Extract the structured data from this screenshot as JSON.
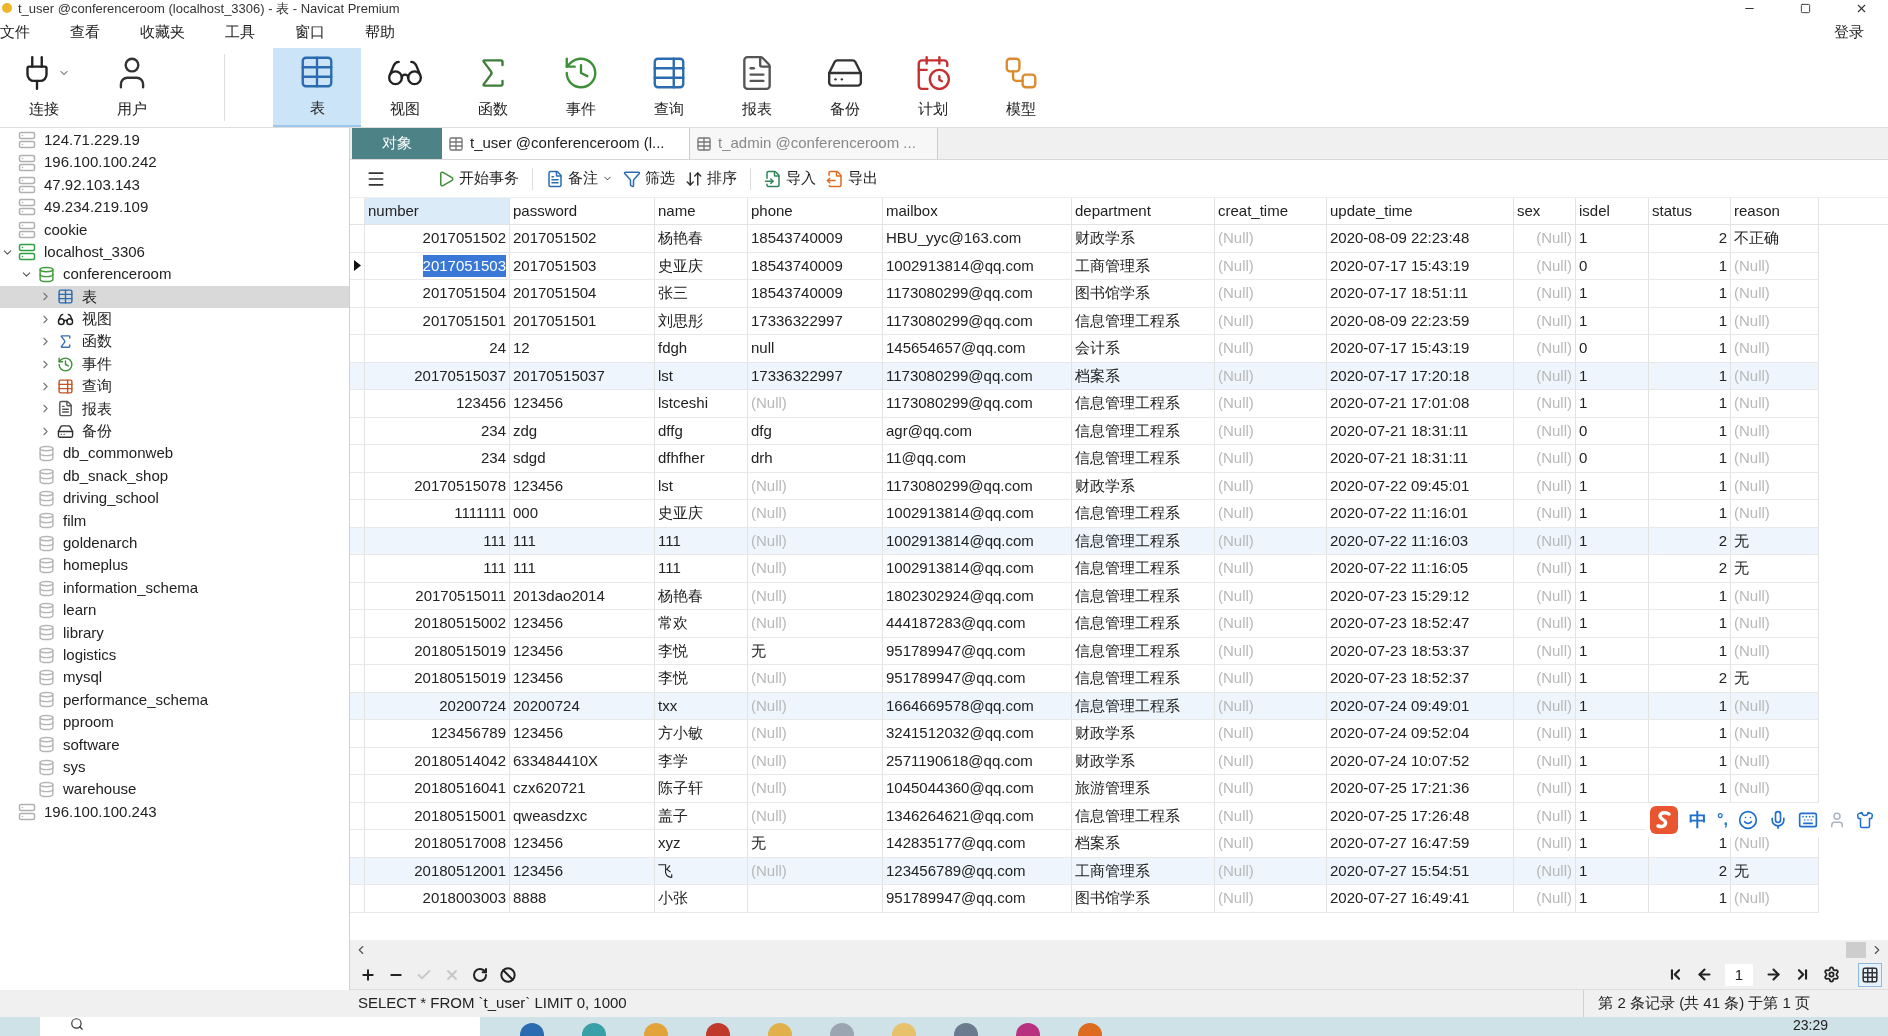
{
  "window": {
    "title": "t_user @conferenceroom (localhost_3306) - 表 - Navicat Premium"
  },
  "menu": [
    "文件",
    "查看",
    "收藏夹",
    "工具",
    "窗口",
    "帮助"
  ],
  "login": "登录",
  "toolbar": [
    {
      "kind": "connection",
      "label": "连接",
      "selected": false
    },
    {
      "kind": "user",
      "label": "用户",
      "selected": false
    },
    {
      "kind": "table",
      "label": "表",
      "selected": true
    },
    {
      "kind": "view",
      "label": "视图",
      "selected": false
    },
    {
      "kind": "function",
      "label": "函数",
      "selected": false
    },
    {
      "kind": "event",
      "label": "事件",
      "selected": false
    },
    {
      "kind": "query",
      "label": "查询",
      "selected": false
    },
    {
      "kind": "report",
      "label": "报表",
      "selected": false
    },
    {
      "kind": "backup",
      "label": "备份",
      "selected": false
    },
    {
      "kind": "schedule",
      "label": "计划",
      "selected": false
    },
    {
      "kind": "model",
      "label": "模型",
      "selected": false
    }
  ],
  "sidebar": {
    "items": [
      {
        "kind": "connection",
        "label": "124.71.229.19",
        "open": false
      },
      {
        "kind": "connection",
        "label": "196.100.100.242",
        "open": false
      },
      {
        "kind": "connection",
        "label": "47.92.103.143",
        "open": false
      },
      {
        "kind": "connection",
        "label": "49.234.219.109",
        "open": false
      },
      {
        "kind": "connection",
        "label": "cookie",
        "open": false
      },
      {
        "kind": "connection",
        "label": "localhost_3306",
        "open": true,
        "expanded": true,
        "children": [
          {
            "kind": "database",
            "label": "conferenceroom",
            "open": true,
            "expanded": true,
            "children": [
              {
                "kind": "tables",
                "label": "表",
                "expanded": false,
                "selected": true
              },
              {
                "kind": "views",
                "label": "视图",
                "expanded": false,
                "selected": false
              },
              {
                "kind": "functions",
                "label": "函数",
                "expanded": false,
                "selected": false
              },
              {
                "kind": "events",
                "label": "事件",
                "expanded": false,
                "selected": false
              },
              {
                "kind": "queries",
                "label": "查询",
                "expanded": false,
                "selected": false
              },
              {
                "kind": "reports",
                "label": "报表",
                "expanded": false,
                "selected": false
              },
              {
                "kind": "backups",
                "label": "备份",
                "expanded": false,
                "selected": false
              }
            ]
          },
          {
            "kind": "database",
            "label": "db_commonweb",
            "open": false
          },
          {
            "kind": "database",
            "label": "db_snack_shop",
            "open": false
          },
          {
            "kind": "database",
            "label": "driving_school",
            "open": false
          },
          {
            "kind": "database",
            "label": "film",
            "open": false
          },
          {
            "kind": "database",
            "label": "goldenarch",
            "open": false
          },
          {
            "kind": "database",
            "label": "homeplus",
            "open": false
          },
          {
            "kind": "database",
            "label": "information_schema",
            "open": false
          },
          {
            "kind": "database",
            "label": "learn",
            "open": false
          },
          {
            "kind": "database",
            "label": "library",
            "open": false
          },
          {
            "kind": "database",
            "label": "logistics",
            "open": false
          },
          {
            "kind": "database",
            "label": "mysql",
            "open": false
          },
          {
            "kind": "database",
            "label": "performance_schema",
            "open": false
          },
          {
            "kind": "database",
            "label": "pproom",
            "open": false
          },
          {
            "kind": "database",
            "label": "software",
            "open": false
          },
          {
            "kind": "database",
            "label": "sys",
            "open": false
          },
          {
            "kind": "database",
            "label": "warehouse",
            "open": false
          }
        ]
      },
      {
        "kind": "connection",
        "label": "196.100.100.243",
        "open": false
      }
    ]
  },
  "tabs": [
    {
      "kind": "objects",
      "label": "对象",
      "selected": false
    },
    {
      "kind": "table",
      "label": "t_user @conferenceroom (l...",
      "selected": true
    },
    {
      "kind": "table",
      "label": "t_admin @conferenceroom ...",
      "selected": false
    }
  ],
  "table_toolbar": [
    {
      "kind": "transaction",
      "label": "开始事务"
    },
    {
      "kind": "memo",
      "label": "备注"
    },
    {
      "kind": "filter",
      "label": "筛选"
    },
    {
      "kind": "sort",
      "label": "排序"
    },
    {
      "kind": "import",
      "label": "导入"
    },
    {
      "kind": "export",
      "label": "导出"
    }
  ],
  "table": {
    "columns": [
      {
        "label": "number",
        "kind": "int",
        "selected": true
      },
      {
        "label": "password",
        "kind": "text",
        "selected": false
      },
      {
        "label": "name",
        "kind": "text",
        "selected": false
      },
      {
        "label": "phone",
        "kind": "text",
        "selected": false
      },
      {
        "label": "mailbox",
        "kind": "text",
        "selected": false
      },
      {
        "label": "department",
        "kind": "text",
        "selected": false
      },
      {
        "label": "creat_time",
        "kind": "text",
        "selected": false
      },
      {
        "label": "update_time",
        "kind": "text",
        "selected": false
      },
      {
        "label": "sex",
        "kind": "int",
        "selected": false
      },
      {
        "label": "isdel",
        "kind": "text",
        "selected": false
      },
      {
        "label": "status",
        "kind": "int",
        "selected": false
      },
      {
        "label": "reason",
        "kind": "text",
        "selected": false
      }
    ],
    "rows": [
      {
        "selected": false,
        "tinted": false,
        "cells": [
          "2017051502",
          "2017051502",
          "杨艳春",
          "18543740009",
          "HBU_yyc@163.com",
          "财政学系",
          {
            "kind": "null",
            "text": "(Null)"
          },
          "2020-08-09 22:23:48",
          {
            "kind": "null",
            "text": "(Null)"
          },
          "1",
          "2",
          "不正确"
        ]
      },
      {
        "selected": true,
        "tinted": false,
        "cells": [
          "2017051503",
          "2017051503",
          "史亚庆",
          "18543740009",
          "1002913814@qq.com",
          "工商管理系",
          {
            "kind": "null",
            "text": "(Null)"
          },
          "2020-07-17 15:43:19",
          {
            "kind": "null",
            "text": "(Null)"
          },
          "0",
          "1",
          {
            "kind": "null",
            "text": "(Null)"
          }
        ]
      },
      {
        "selected": false,
        "tinted": false,
        "cells": [
          "2017051504",
          "2017051504",
          "张三",
          "18543740009",
          "1173080299@qq.com",
          "图书馆学系",
          {
            "kind": "null",
            "text": "(Null)"
          },
          "2020-07-17 18:51:11",
          {
            "kind": "null",
            "text": "(Null)"
          },
          "1",
          "1",
          {
            "kind": "null",
            "text": "(Null)"
          }
        ]
      },
      {
        "selected": false,
        "tinted": false,
        "cells": [
          "2017051501",
          "2017051501",
          "刘思彤",
          "17336322997",
          "1173080299@qq.com",
          "信息管理工程系",
          {
            "kind": "null",
            "text": "(Null)"
          },
          "2020-08-09 22:23:59",
          {
            "kind": "null",
            "text": "(Null)"
          },
          "1",
          "1",
          {
            "kind": "null",
            "text": "(Null)"
          }
        ]
      },
      {
        "selected": false,
        "tinted": false,
        "cells": [
          "24",
          "12",
          "fdgh",
          "null",
          "145654657@qq.com",
          "会计系",
          {
            "kind": "null",
            "text": "(Null)"
          },
          "2020-07-17 15:43:19",
          {
            "kind": "null",
            "text": "(Null)"
          },
          "0",
          "1",
          {
            "kind": "null",
            "text": "(Null)"
          }
        ]
      },
      {
        "selected": false,
        "tinted": true,
        "cells": [
          "20170515037",
          "20170515037",
          "lst",
          "17336322997",
          "1173080299@qq.com",
          "档案系",
          {
            "kind": "null",
            "text": "(Null)"
          },
          "2020-07-17 17:20:18",
          {
            "kind": "null",
            "text": "(Null)"
          },
          "1",
          "1",
          {
            "kind": "null",
            "text": "(Null)"
          }
        ]
      },
      {
        "selected": false,
        "tinted": false,
        "cells": [
          "123456",
          "123456",
          "lstceshi",
          {
            "kind": "null",
            "text": "(Null)"
          },
          "1173080299@qq.com",
          "信息管理工程系",
          {
            "kind": "null",
            "text": "(Null)"
          },
          "2020-07-21 17:01:08",
          {
            "kind": "null",
            "text": "(Null)"
          },
          "1",
          "1",
          {
            "kind": "null",
            "text": "(Null)"
          }
        ]
      },
      {
        "selected": false,
        "tinted": false,
        "cells": [
          "234",
          "zdg",
          "dffg",
          "dfg",
          "agr@qq.com",
          "信息管理工程系",
          {
            "kind": "null",
            "text": "(Null)"
          },
          "2020-07-21 18:31:11",
          {
            "kind": "null",
            "text": "(Null)"
          },
          "0",
          "1",
          {
            "kind": "null",
            "text": "(Null)"
          }
        ]
      },
      {
        "selected": false,
        "tinted": false,
        "cells": [
          "234",
          "sdgd",
          "dfhfher",
          "drh",
          "11@qq.com",
          "信息管理工程系",
          {
            "kind": "null",
            "text": "(Null)"
          },
          "2020-07-21 18:31:11",
          {
            "kind": "null",
            "text": "(Null)"
          },
          "0",
          "1",
          {
            "kind": "null",
            "text": "(Null)"
          }
        ]
      },
      {
        "selected": false,
        "tinted": false,
        "cells": [
          "20170515078",
          "123456",
          "lst",
          {
            "kind": "null",
            "text": "(Null)"
          },
          "1173080299@qq.com",
          "财政学系",
          {
            "kind": "null",
            "text": "(Null)"
          },
          "2020-07-22 09:45:01",
          {
            "kind": "null",
            "text": "(Null)"
          },
          "1",
          "1",
          {
            "kind": "null",
            "text": "(Null)"
          }
        ]
      },
      {
        "selected": false,
        "tinted": false,
        "cells": [
          "1111111",
          "000",
          "史亚庆",
          {
            "kind": "null",
            "text": "(Null)"
          },
          "1002913814@qq.com",
          "信息管理工程系",
          {
            "kind": "null",
            "text": "(Null)"
          },
          "2020-07-22 11:16:01",
          {
            "kind": "null",
            "text": "(Null)"
          },
          "1",
          "1",
          {
            "kind": "null",
            "text": "(Null)"
          }
        ]
      },
      {
        "selected": false,
        "tinted": true,
        "cells": [
          "111",
          "111",
          "111",
          {
            "kind": "null",
            "text": "(Null)"
          },
          "1002913814@qq.com",
          "信息管理工程系",
          {
            "kind": "null",
            "text": "(Null)"
          },
          "2020-07-22 11:16:03",
          {
            "kind": "null",
            "text": "(Null)"
          },
          "1",
          "2",
          "无"
        ]
      },
      {
        "selected": false,
        "tinted": false,
        "cells": [
          "111",
          "111",
          "111",
          {
            "kind": "null",
            "text": "(Null)"
          },
          "1002913814@qq.com",
          "信息管理工程系",
          {
            "kind": "null",
            "text": "(Null)"
          },
          "2020-07-22 11:16:05",
          {
            "kind": "null",
            "text": "(Null)"
          },
          "1",
          "2",
          "无"
        ]
      },
      {
        "selected": false,
        "tinted": false,
        "cells": [
          "20170515011",
          "2013dao2014",
          "杨艳春",
          {
            "kind": "null",
            "text": "(Null)"
          },
          "1802302924@qq.com",
          "信息管理工程系",
          {
            "kind": "null",
            "text": "(Null)"
          },
          "2020-07-23 15:29:12",
          {
            "kind": "null",
            "text": "(Null)"
          },
          "1",
          "1",
          {
            "kind": "null",
            "text": "(Null)"
          }
        ]
      },
      {
        "selected": false,
        "tinted": false,
        "cells": [
          "20180515002",
          "123456",
          "常欢",
          {
            "kind": "null",
            "text": "(Null)"
          },
          "444187283@qq.com",
          "信息管理工程系",
          {
            "kind": "null",
            "text": "(Null)"
          },
          "2020-07-23 18:52:47",
          {
            "kind": "null",
            "text": "(Null)"
          },
          "1",
          "1",
          {
            "kind": "null",
            "text": "(Null)"
          }
        ]
      },
      {
        "selected": false,
        "tinted": false,
        "cells": [
          "20180515019",
          "123456",
          "李悦",
          "无",
          "951789947@qq.com",
          "信息管理工程系",
          {
            "kind": "null",
            "text": "(Null)"
          },
          "2020-07-23 18:53:37",
          {
            "kind": "null",
            "text": "(Null)"
          },
          "1",
          "1",
          {
            "kind": "null",
            "text": "(Null)"
          }
        ]
      },
      {
        "selected": false,
        "tinted": false,
        "cells": [
          "20180515019",
          "123456",
          "李悦",
          {
            "kind": "null",
            "text": "(Null)"
          },
          "951789947@qq.com",
          "信息管理工程系",
          {
            "kind": "null",
            "text": "(Null)"
          },
          "2020-07-23 18:52:37",
          {
            "kind": "null",
            "text": "(Null)"
          },
          "1",
          "2",
          "无"
        ]
      },
      {
        "selected": false,
        "tinted": true,
        "cells": [
          "20200724",
          "20200724",
          "txx",
          {
            "kind": "null",
            "text": "(Null)"
          },
          "1664669578@qq.com",
          "信息管理工程系",
          {
            "kind": "null",
            "text": "(Null)"
          },
          "2020-07-24 09:49:01",
          {
            "kind": "null",
            "text": "(Null)"
          },
          "1",
          "1",
          {
            "kind": "null",
            "text": "(Null)"
          }
        ]
      },
      {
        "selected": false,
        "tinted": false,
        "cells": [
          "123456789",
          "123456",
          "方小敏",
          {
            "kind": "null",
            "text": "(Null)"
          },
          "3241512032@qq.com",
          "财政学系",
          {
            "kind": "null",
            "text": "(Null)"
          },
          "2020-07-24 09:52:04",
          {
            "kind": "null",
            "text": "(Null)"
          },
          "1",
          "1",
          {
            "kind": "null",
            "text": "(Null)"
          }
        ]
      },
      {
        "selected": false,
        "tinted": false,
        "cells": [
          "20180514042",
          "633484410X",
          "李学",
          {
            "kind": "null",
            "text": "(Null)"
          },
          "2571190618@qq.com",
          "财政学系",
          {
            "kind": "null",
            "text": "(Null)"
          },
          "2020-07-24 10:07:52",
          {
            "kind": "null",
            "text": "(Null)"
          },
          "1",
          "1",
          {
            "kind": "null",
            "text": "(Null)"
          }
        ]
      },
      {
        "selected": false,
        "tinted": false,
        "cells": [
          "20180516041",
          "czx620721",
          "陈子轩",
          {
            "kind": "null",
            "text": "(Null)"
          },
          "1045044360@qq.com",
          "旅游管理系",
          {
            "kind": "null",
            "text": "(Null)"
          },
          "2020-07-25 17:21:36",
          {
            "kind": "null",
            "text": "(Null)"
          },
          "1",
          "1",
          {
            "kind": "null",
            "text": "(Null)"
          }
        ]
      },
      {
        "selected": false,
        "tinted": false,
        "cells": [
          "20180515001",
          "qweasdzxc",
          "盖子",
          {
            "kind": "null",
            "text": "(Null)"
          },
          "1346264621@qq.com",
          "信息管理工程系",
          {
            "kind": "null",
            "text": "(Null)"
          },
          "2020-07-25 17:26:48",
          {
            "kind": "null",
            "text": "(Null)"
          },
          "1",
          null,
          null
        ]
      },
      {
        "selected": false,
        "tinted": false,
        "cells": [
          "20180517008",
          "123456",
          "xyz",
          "无",
          "142835177@qq.com",
          "档案系",
          {
            "kind": "null",
            "text": "(Null)"
          },
          "2020-07-27 16:47:59",
          {
            "kind": "null",
            "text": "(Null)"
          },
          "1",
          "1",
          {
            "kind": "null",
            "text": "(Null)"
          }
        ]
      },
      {
        "selected": false,
        "tinted": true,
        "cells": [
          "20180512001",
          "123456",
          "飞",
          {
            "kind": "null",
            "text": "(Null)"
          },
          "123456789@qq.com",
          "工商管理系",
          {
            "kind": "null",
            "text": "(Null)"
          },
          "2020-07-27 15:54:51",
          {
            "kind": "null",
            "text": "(Null)"
          },
          "1",
          "2",
          "无"
        ]
      },
      {
        "selected": false,
        "tinted": false,
        "cells": [
          "2018003003",
          "8888",
          "小张",
          null,
          "951789947@qq.com",
          "图书馆学系",
          {
            "kind": "null",
            "text": "(Null)"
          },
          "2020-07-27 16:49:41",
          {
            "kind": "null",
            "text": "(Null)"
          },
          "1",
          "1",
          {
            "kind": "null",
            "text": "(Null)"
          }
        ]
      }
    ]
  },
  "record_buttons": [
    {
      "kind": "add",
      "disabled": false
    },
    {
      "kind": "delete",
      "disabled": false
    },
    {
      "kind": "apply",
      "disabled": true
    },
    {
      "kind": "discard",
      "disabled": true
    },
    {
      "kind": "refresh",
      "disabled": false
    },
    {
      "kind": "stop",
      "disabled": false
    }
  ],
  "pager": {
    "page": "1"
  },
  "status_bar": {
    "sql": "SELECT * FROM `t_user` LIMIT 0, 1000",
    "record": "第 2 条记录 (共 41 条) 于第 1 页"
  },
  "ime_toolbar": {
    "mode": "中",
    "punctuation": "°,"
  },
  "taskbar": {
    "time": "23:29"
  }
}
